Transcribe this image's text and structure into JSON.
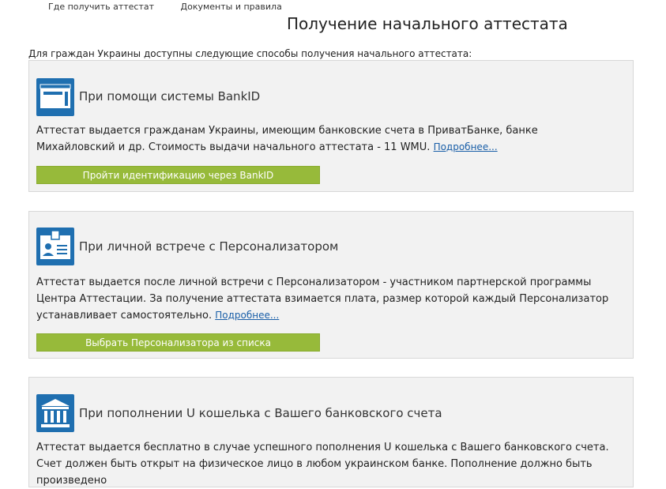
{
  "nav": {
    "where": "Где получить аттестат",
    "docs": "Документы и правила"
  },
  "page_title": "Получение начального аттестата",
  "intro": "Для граждан Украины доступны следующие способы получения начального аттестата:",
  "cards": [
    {
      "title": "При помощи системы BankID",
      "icon": "browser-window-icon",
      "desc_before": "Аттестат выдается гражданам Украины, имеющим банковские счета в ПриватБанке, банке Михайловский и др. Стоимость выдачи начального аттестата - 11 WMU.",
      "link": "Подробнее...",
      "button": "Пройти идентификацию через BankID"
    },
    {
      "title": "При личной встрече с Персонализатором",
      "icon": "id-badge-icon",
      "desc_before": "Аттестат выдается после личной встречи с Персонализатором - участником партнерской программы Центра Аттестации. За получение аттестата взимается плата, размер которой каждый Персонализатор устанавливает самостоятельно.",
      "link": "Подробнее...",
      "button": "Выбрать Персонализатора из списка"
    },
    {
      "title": "При пополнении U кошелька с Вашего банковского счета",
      "icon": "bank-building-icon",
      "desc_before": "Аттестат выдается бесплатно в случае успешного пополнения U кошелька с Вашего банковского счета. Счет должен быть открыт на физическое лицо в любом украинском банке. Пополнение должно быть произведено"
    }
  ],
  "colors": {
    "accent_blue": "#1f6fb0",
    "button_green": "#97ba3a",
    "card_bg": "#f2f2f2"
  }
}
